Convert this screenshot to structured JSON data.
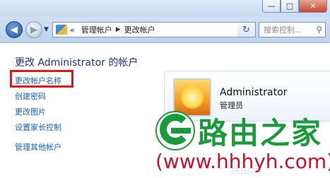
{
  "window": {
    "minimize_label": "—",
    "maximize_label": "□",
    "close_label": "✕"
  },
  "nav": {
    "back_label": "◀",
    "forward_label": "▶",
    "dropdown_label": "▼",
    "breadcrumb_prefix": "«",
    "breadcrumbs": [
      "管理帐户",
      "更改帐户"
    ],
    "separator": "▶",
    "address_dropdown": "▼",
    "refresh_label": "↻",
    "search_placeholder": "搜索控制...",
    "search_icon": "⚲"
  },
  "main": {
    "title": "更改 Administrator 的帐户",
    "tasks": [
      "更改帐户名称",
      "创建密码",
      "更改图片",
      "设置家长控制",
      "管理其他帐户"
    ]
  },
  "user": {
    "name": "Administrator",
    "role": "管理员"
  },
  "branding": {
    "logo_text": "路由之家",
    "watermark": "路由网",
    "url": "(www.hhhyh.com)"
  },
  "colors": {
    "highlight_box": "#e2141d",
    "logo_green": "#1a9a3b",
    "url_red": "#c8102e",
    "link_blue": "#1560bd",
    "title_blue": "#1e3287"
  }
}
